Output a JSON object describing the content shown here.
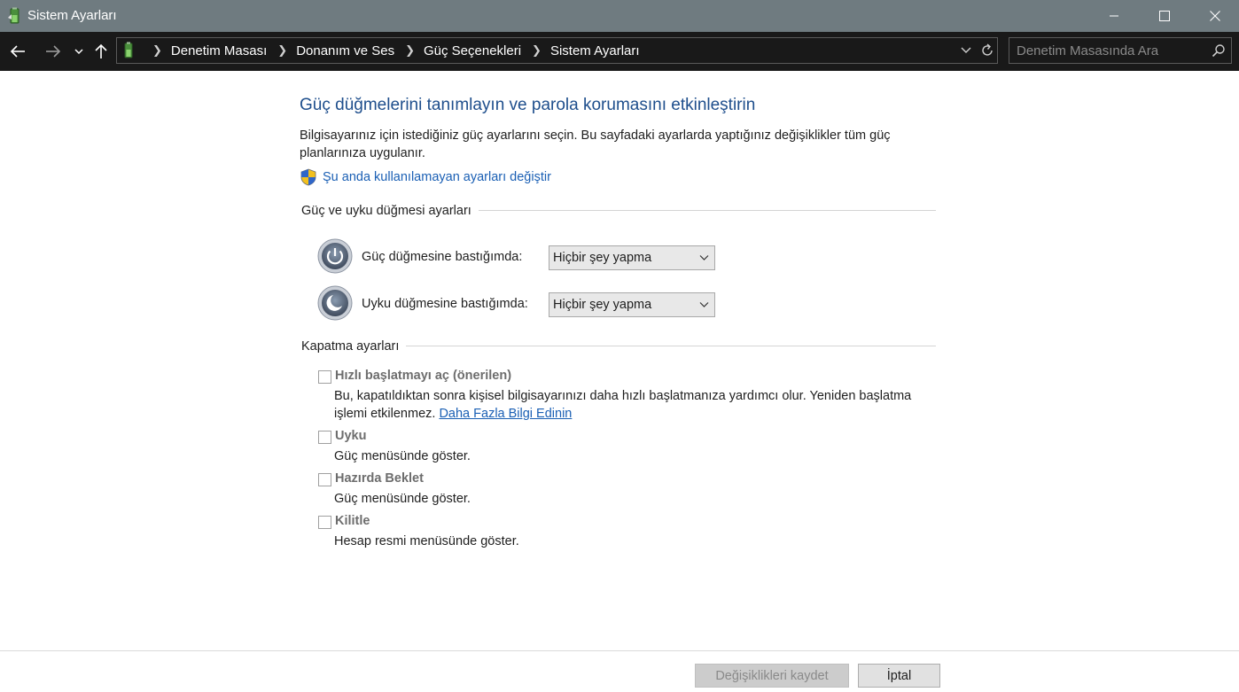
{
  "window": {
    "title": "Sistem Ayarları",
    "minimize_icon": "minimize-icon",
    "maximize_icon": "maximize-icon",
    "close_icon": "close-icon"
  },
  "navigation": {
    "breadcrumbs": [
      "Denetim Masası",
      "Donanım ve Ses",
      "Güç Seçenekleri",
      "Sistem Ayarları"
    ],
    "search_placeholder": "Denetim Masasında Ara"
  },
  "main": {
    "heading": "Güç düğmelerini tanımlayın ve parola korumasını etkinleştirin",
    "description": "Bilgisayarınız için istediğiniz güç ayarlarını seçin. Bu sayfadaki ayarlarda yaptığınız değişiklikler tüm güç planlarınıza uygulanır.",
    "admin_link": "Şu anda kullanılamayan ayarları değiştir",
    "power_section": {
      "title": "Güç ve uyku düğmesi ayarları",
      "power_button_label": "Güç düğmesine bastığımda:",
      "power_button_value": "Hiçbir şey yapma",
      "sleep_button_label": "Uyku düğmesine bastığımda:",
      "sleep_button_value": "Hiçbir şey yapma"
    },
    "shutdown_section": {
      "title": "Kapatma ayarları",
      "options": [
        {
          "title": "Hızlı başlatmayı aç (önerilen)",
          "description": "Bu, kapatıldıktan sonra kişisel bilgisayarınızı daha hızlı başlatmanıza yardımcı olur. Yeniden başlatma işlemi etkilenmez. ",
          "link": "Daha Fazla Bilgi Edinin",
          "checked": false
        },
        {
          "title": "Uyku",
          "description": "Güç menüsünde göster.",
          "checked": false
        },
        {
          "title": "Hazırda Beklet",
          "description": "Güç menüsünde göster.",
          "checked": false
        },
        {
          "title": "Kilitle",
          "description": "Hesap resmi menüsünde göster.",
          "checked": false
        }
      ]
    }
  },
  "footer": {
    "save_label": "Değişiklikleri kaydet",
    "cancel_label": "İptal"
  }
}
